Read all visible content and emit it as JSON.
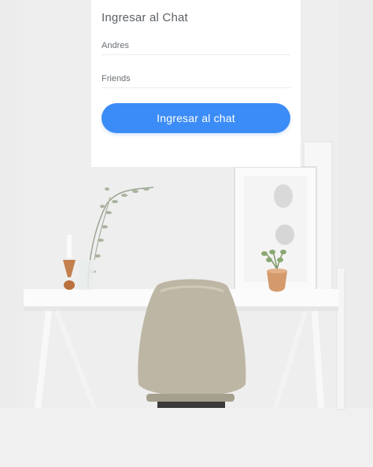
{
  "login": {
    "title": "Ingresar al Chat",
    "username_value": "Andres",
    "room_value": "Friends",
    "submit_label": "Ingresar al chat"
  },
  "colors": {
    "accent": "#3b8cf6",
    "card_background": "#ffffff",
    "page_background": "#efefef"
  },
  "background_image": {
    "icon": "desk-chair-photo"
  }
}
